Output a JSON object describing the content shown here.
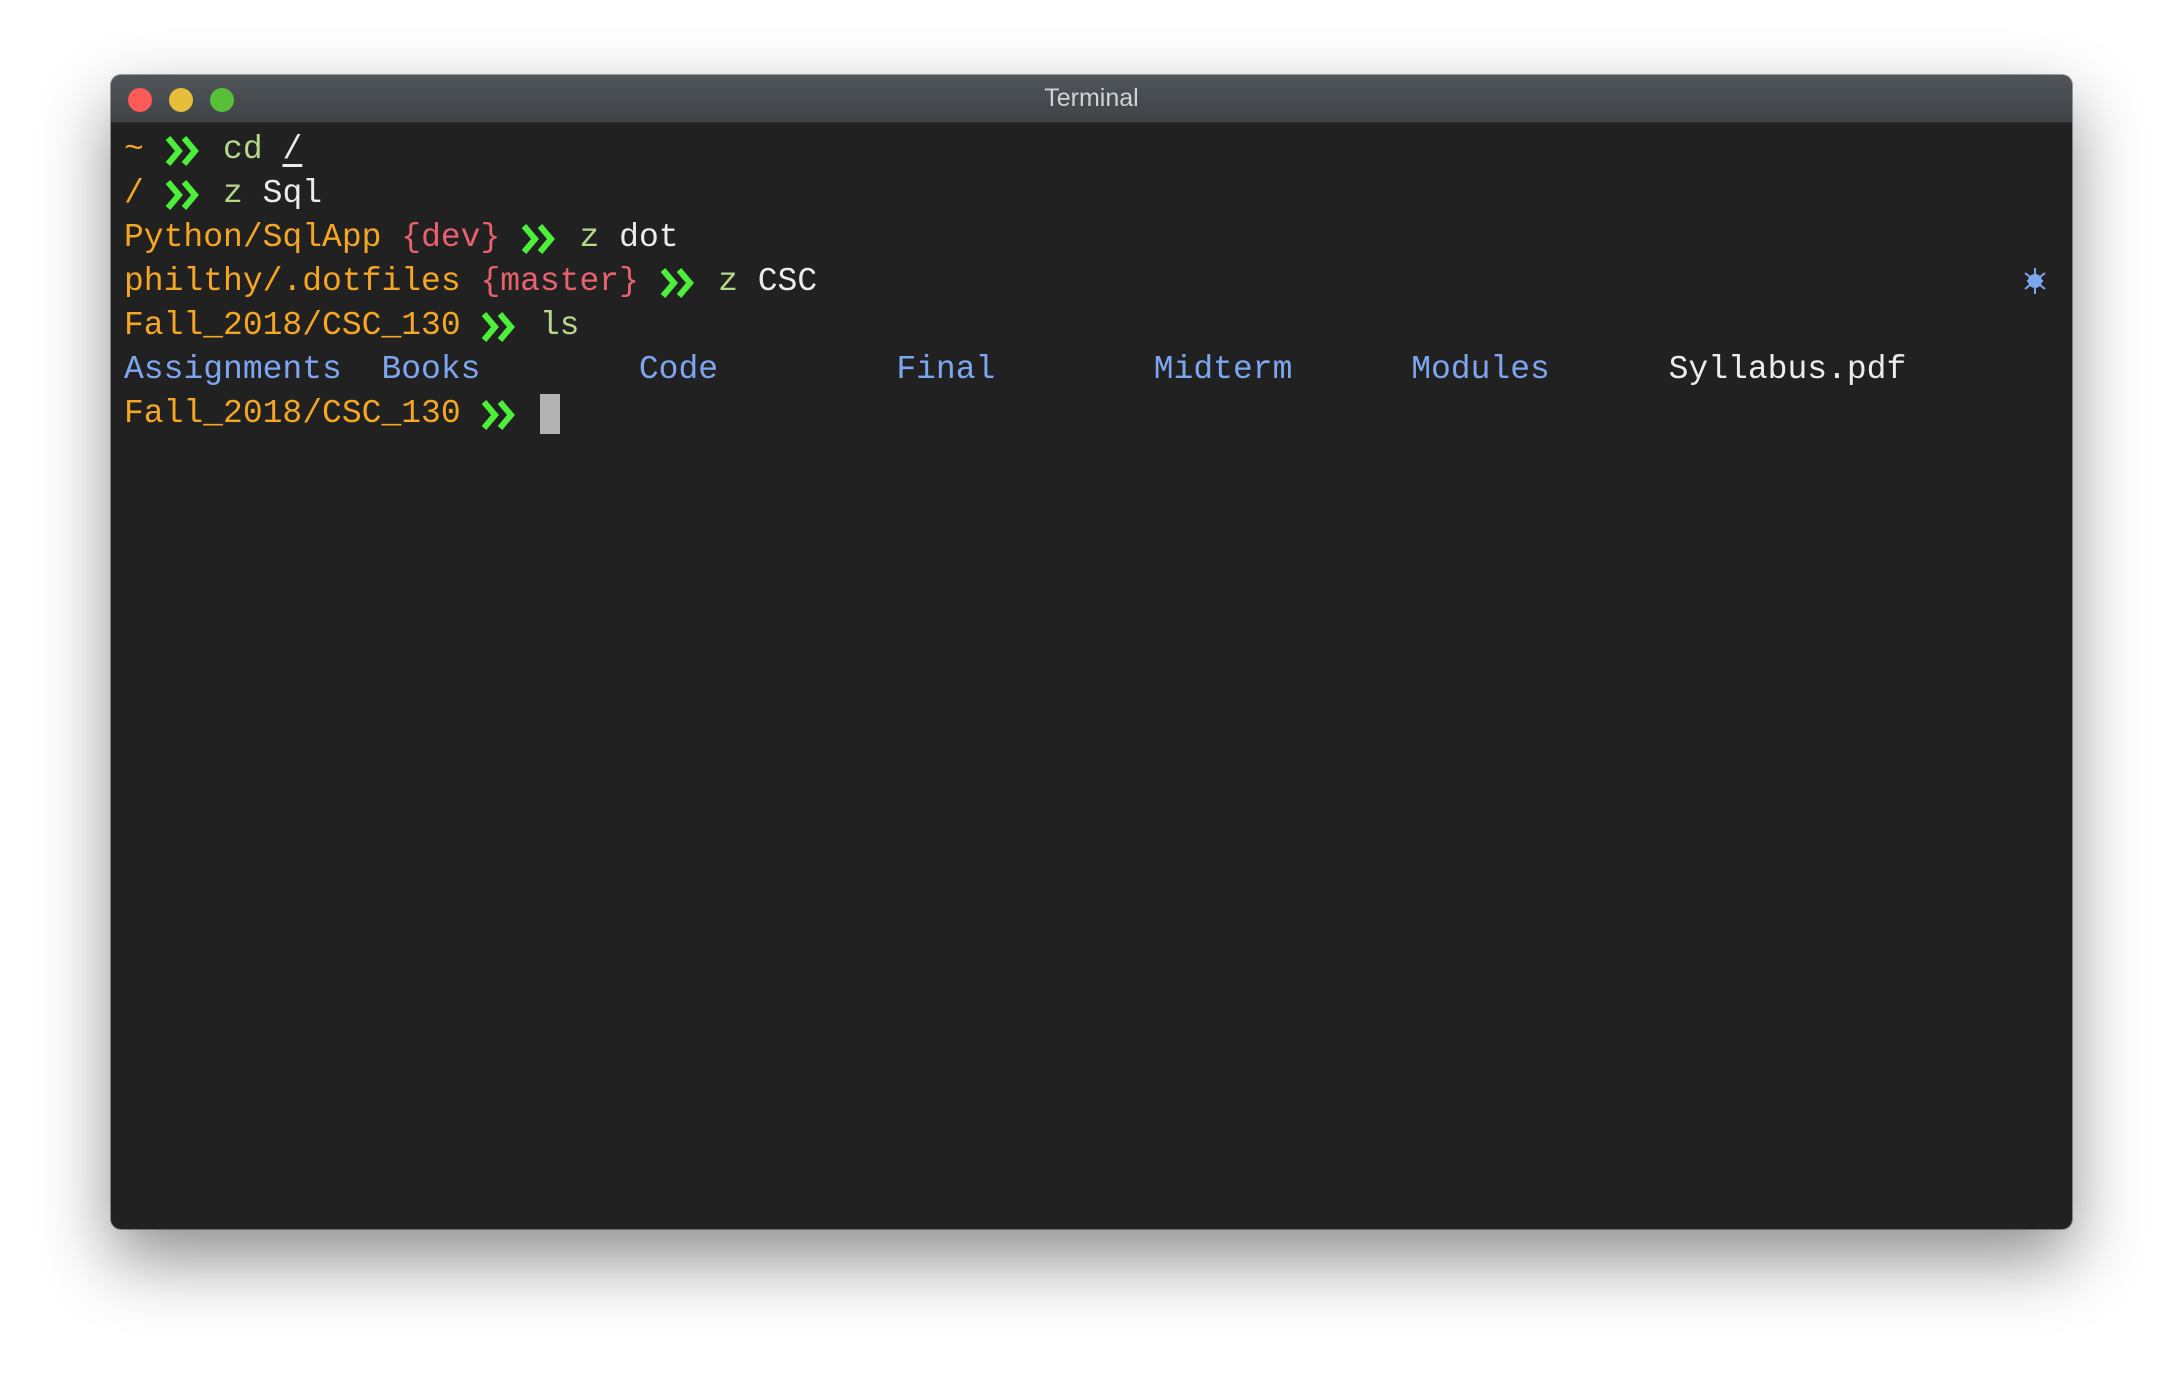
{
  "window": {
    "title": "Terminal"
  },
  "colors": {
    "path": "#f5a623",
    "branch": "#e8616c",
    "chevron": "#4cf03a",
    "command": "#b5d88a",
    "directory": "#7ea6f0",
    "background": "#212121"
  },
  "lines": [
    {
      "segments": [
        {
          "t": "path",
          "v": "~"
        },
        {
          "t": "chev"
        },
        {
          "t": "cmd",
          "v": "cd"
        },
        {
          "t": "argu",
          "v": "/"
        }
      ]
    },
    {
      "segments": [
        {
          "t": "path",
          "v": "/"
        },
        {
          "t": "chev"
        },
        {
          "t": "cmd",
          "v": "z"
        },
        {
          "t": "arg",
          "v": "Sql"
        }
      ]
    },
    {
      "segments": [
        {
          "t": "path",
          "v": "Python/SqlApp"
        },
        {
          "t": "branch",
          "v": "{dev}"
        },
        {
          "t": "chev"
        },
        {
          "t": "cmd",
          "v": "z"
        },
        {
          "t": "arg",
          "v": "dot"
        }
      ]
    },
    {
      "segments": [
        {
          "t": "path",
          "v": "philthy/.dotfiles"
        },
        {
          "t": "branch",
          "v": "{master}"
        },
        {
          "t": "chev"
        },
        {
          "t": "cmd",
          "v": "z"
        },
        {
          "t": "arg",
          "v": "CSC"
        }
      ]
    },
    {
      "segments": [
        {
          "t": "path",
          "v": "Fall_2018/CSC_130"
        },
        {
          "t": "chev"
        },
        {
          "t": "cmd",
          "v": "ls"
        }
      ]
    },
    {
      "listing": [
        {
          "name": "Assignments",
          "kind": "dir"
        },
        {
          "name": "Books",
          "kind": "dir"
        },
        {
          "name": "Code",
          "kind": "dir"
        },
        {
          "name": "Final",
          "kind": "dir"
        },
        {
          "name": "Midterm",
          "kind": "dir"
        },
        {
          "name": "Modules",
          "kind": "dir"
        },
        {
          "name": "Syllabus.pdf",
          "kind": "file"
        }
      ]
    },
    {
      "segments": [
        {
          "t": "path",
          "v": "Fall_2018/CSC_130"
        },
        {
          "t": "chev"
        },
        {
          "t": "cursor"
        }
      ]
    }
  ],
  "status_icon": "asterisk-activity-icon"
}
